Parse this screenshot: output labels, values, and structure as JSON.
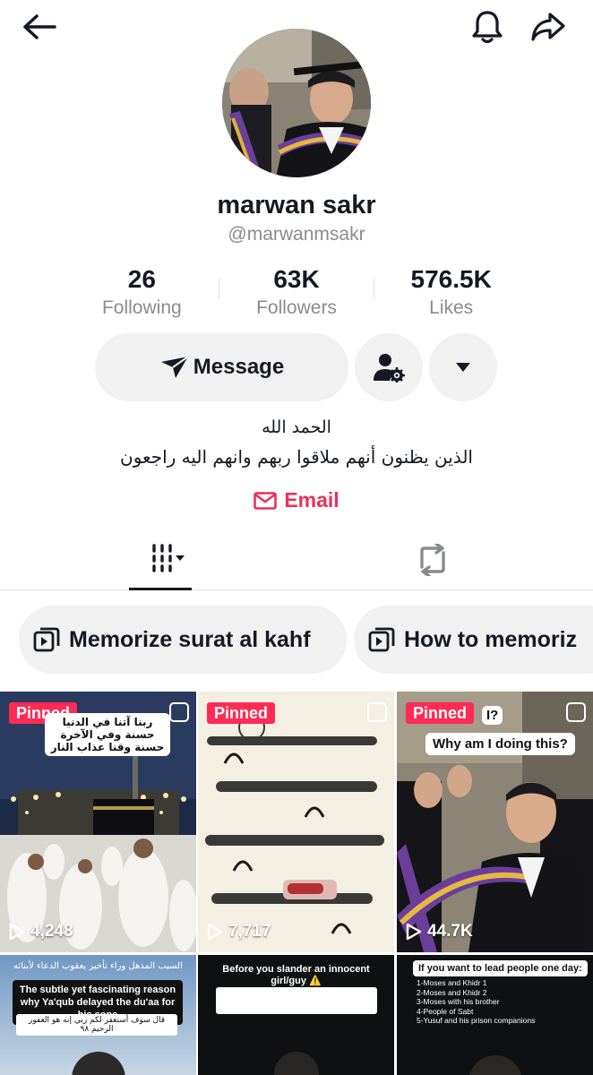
{
  "profile": {
    "name": "marwan sakr",
    "handle": "@marwanmsakr"
  },
  "stats": [
    {
      "value": "26",
      "label": "Following"
    },
    {
      "value": "63K",
      "label": "Followers"
    },
    {
      "value": "576.5K",
      "label": "Likes"
    }
  ],
  "actions": {
    "message_label": "Message"
  },
  "bio": {
    "line1": "الحمد الله",
    "line2": "الذين يظنون أنهم ملاقوا ربهم وانهم اليه راجعون"
  },
  "email_label": "Email",
  "playlists": [
    {
      "label": "Memorize surat al kahf"
    },
    {
      "label": "How to memoriz"
    }
  ],
  "videos": [
    {
      "pinned": "Pinned",
      "views": "4,248",
      "caption": "ربنا آتنا في الدنيا حسنة وفي الآخرة حسنة وقنا عذاب النار"
    },
    {
      "pinned": "Pinned",
      "views": "7,717",
      "caption": ""
    },
    {
      "pinned": "Pinned",
      "views": "44.7K",
      "caption": "Why am I doing this?",
      "caption_top": "I?"
    },
    {
      "caption": "The subtle yet fascinating reason why Ya'qub delayed the du'aa for his sons",
      "caption_ar": "السبب المذهل وراء تأخير يعقوب الدعاء لأبنائه",
      "caption_ar2": "قال سوف أستغفر لكم ربي إنه هو الغفور الرحيم ٩٨"
    },
    {
      "caption": "Before you slander an innocent girl/guy ⚠️"
    },
    {
      "caption": "If you want to lead people one day:",
      "list": [
        "1-Moses and Khidr 1",
        "2-Moses and Khidr 2",
        "3-Moses with his brother",
        "4-People of Sabt",
        "5-Yusuf and his prison companions"
      ]
    }
  ],
  "colors": {
    "accent": "#fe2c55",
    "email": "#e6325a",
    "text": "#161823",
    "muted": "#8a8b91",
    "chip": "#f1f1f2"
  },
  "icons": {
    "back": "arrow-left-icon",
    "bell": "bell-icon",
    "share": "share-icon",
    "message": "send-icon",
    "friend_settings": "user-gear-icon",
    "more": "chevron-down-icon",
    "email": "mail-icon",
    "grid_tab": "grid-icon",
    "repost_tab": "repost-icon",
    "playlist": "playlist-icon",
    "play": "play-icon"
  }
}
